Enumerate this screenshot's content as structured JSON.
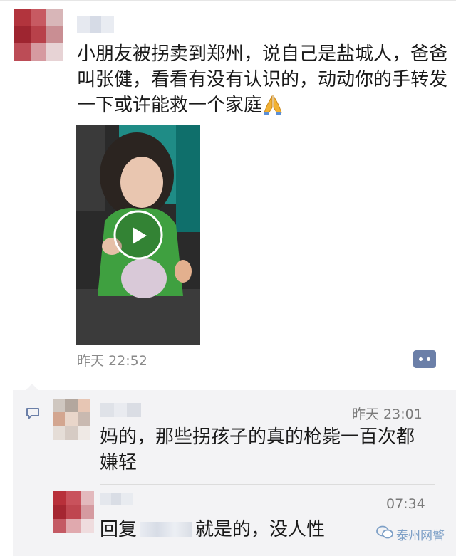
{
  "post": {
    "text": "小朋友被拐卖到郑州，说自己是盐城人，爸爸叫张健，看看有没有认识的，动动你的手转发一下或许能救一个家庭",
    "emoji": "pray-emoji",
    "video_icon": "play-icon",
    "timestamp": "昨天 22:52",
    "comment_button_icon": "comment-more-icon"
  },
  "comments": [
    {
      "time": "昨天 23:01",
      "text": "妈的，那些拐孩子的真的枪毙一百次都嫌轻"
    },
    {
      "time": "07:34",
      "reply_prefix": "回复",
      "text": "就是的，没人性"
    }
  ],
  "watermark": {
    "text": "泰州网警",
    "icon": "wechat-icon"
  },
  "colors": {
    "comment_bg": "#f3f3f5",
    "time_gray": "#8a8a8a",
    "link_blue": "#6b7fa8",
    "watermark_blue": "#7ea0c7"
  }
}
